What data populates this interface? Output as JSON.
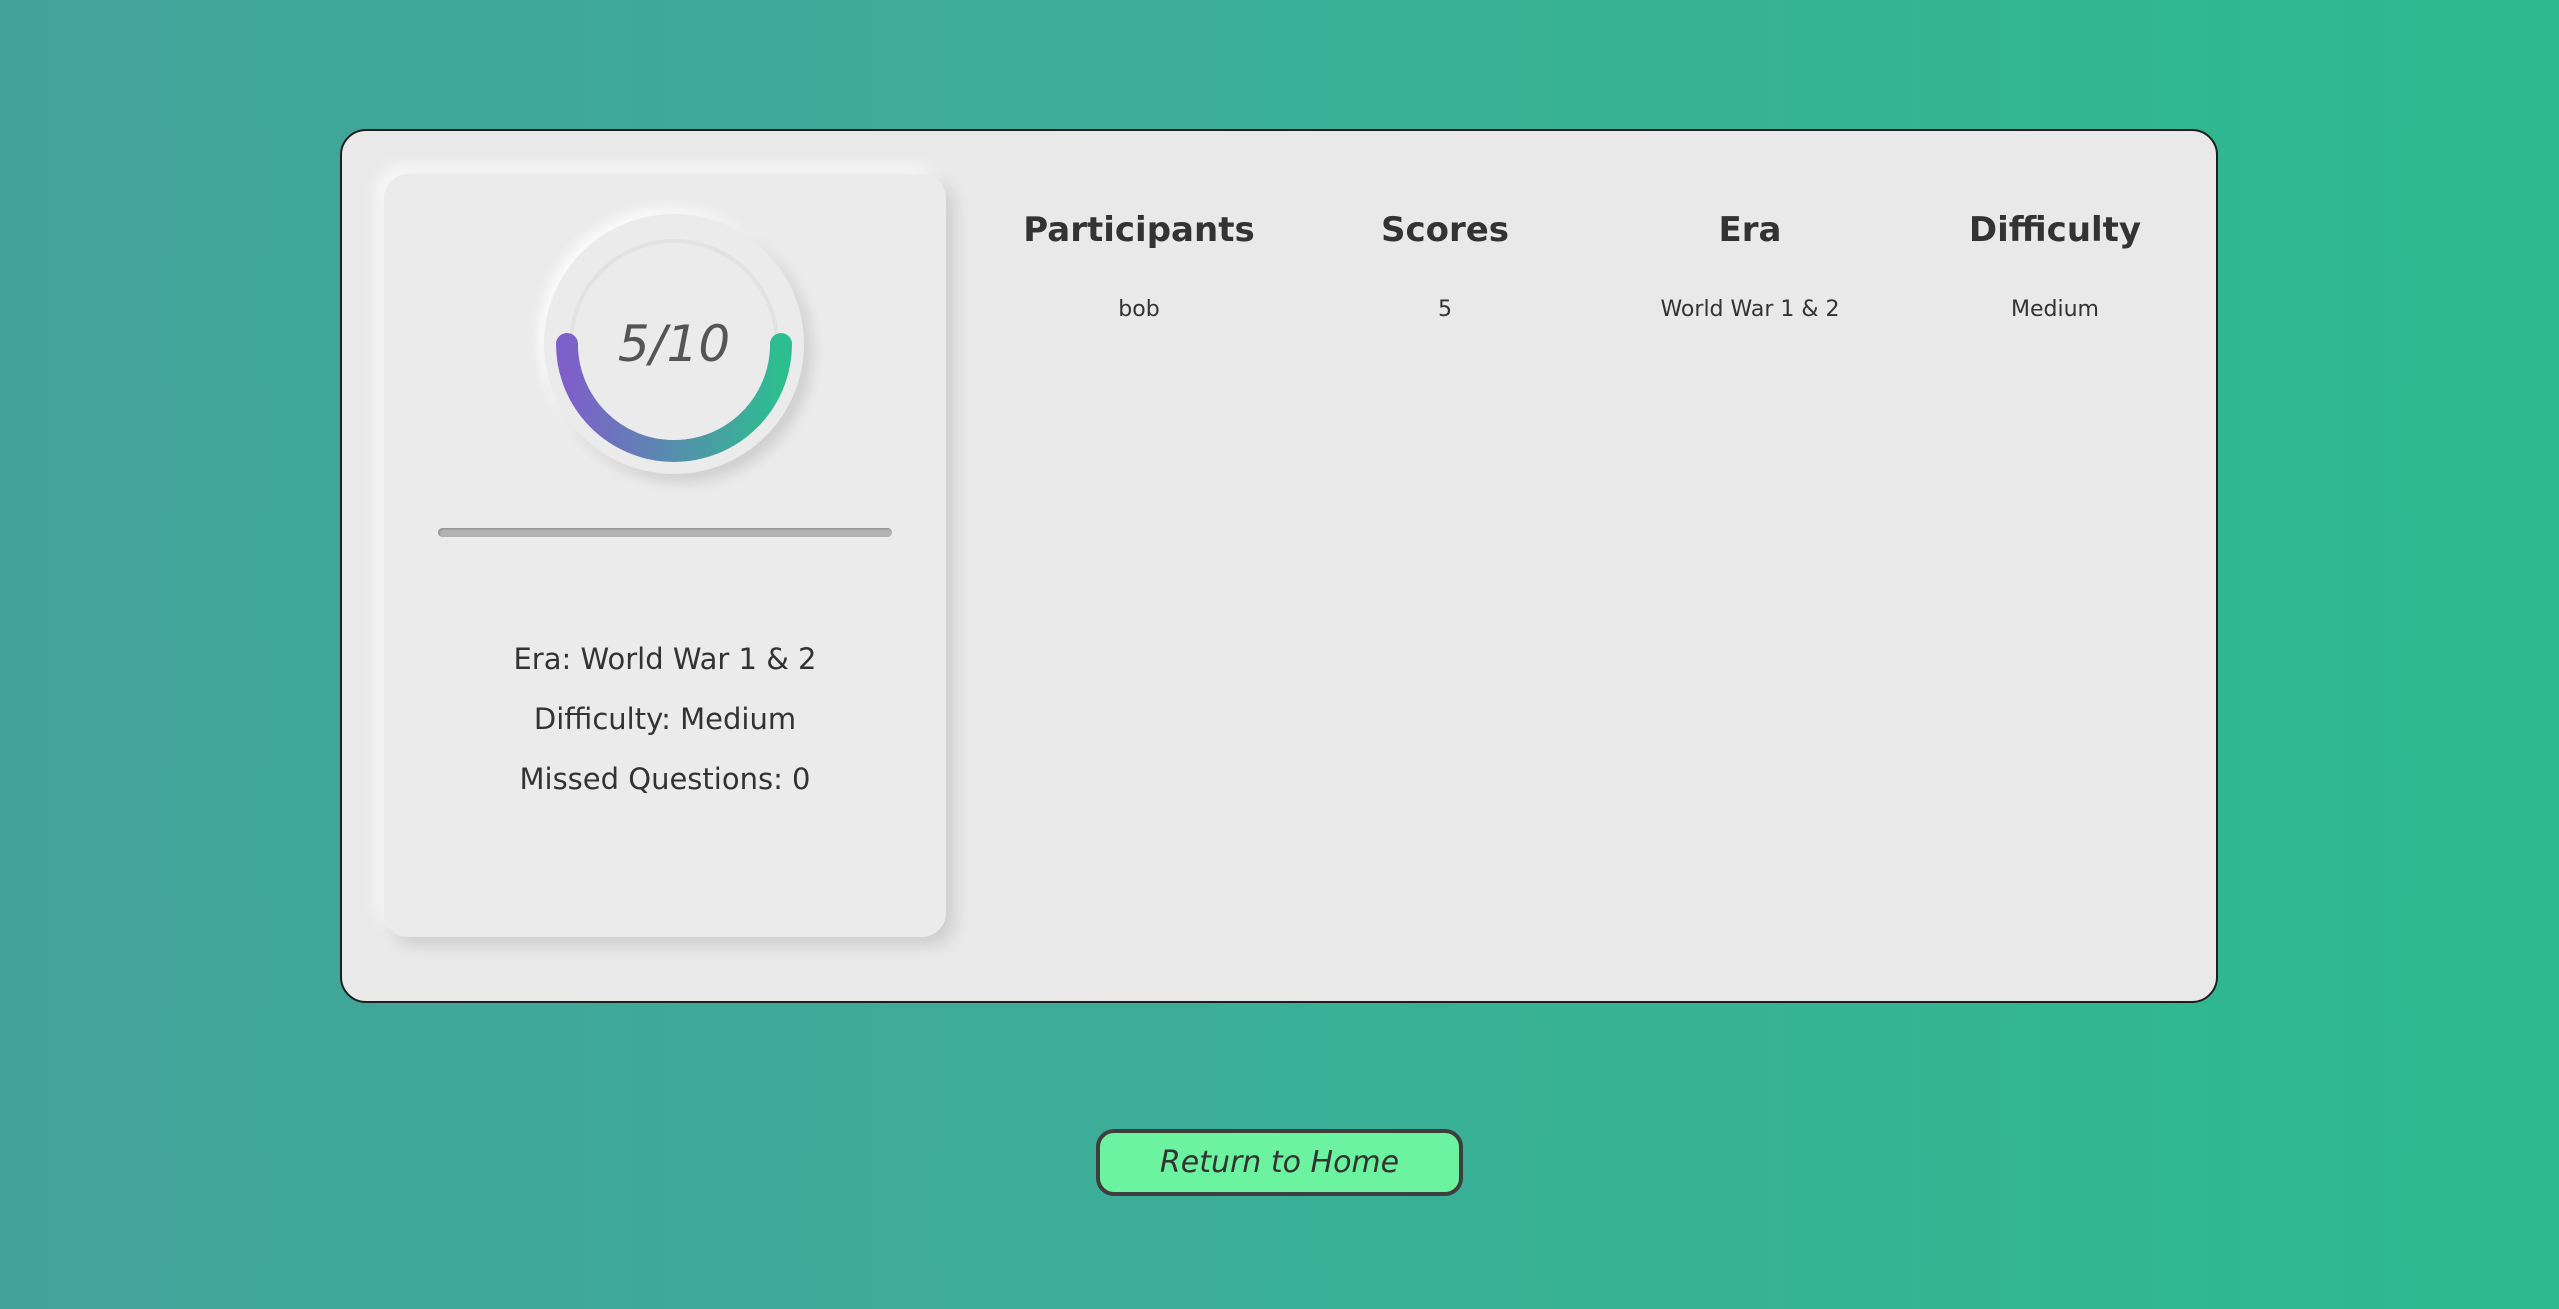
{
  "score_card": {
    "score_text": "5/10",
    "score": 5,
    "total": 10,
    "era_line": "Era: World War 1 & 2",
    "difficulty_line": "Difficulty: Medium",
    "missed_line": "Missed Questions: 0"
  },
  "ring_colors": {
    "start": "#7e5fc9",
    "end": "#2dbe90"
  },
  "leaderboard": {
    "headers": [
      "Participants",
      "Scores",
      "Era",
      "Difficulty"
    ],
    "rows": [
      [
        "bob",
        "5",
        "World War 1 & 2",
        "Medium"
      ]
    ]
  },
  "actions": {
    "return_home_label": "Return to Home"
  }
}
